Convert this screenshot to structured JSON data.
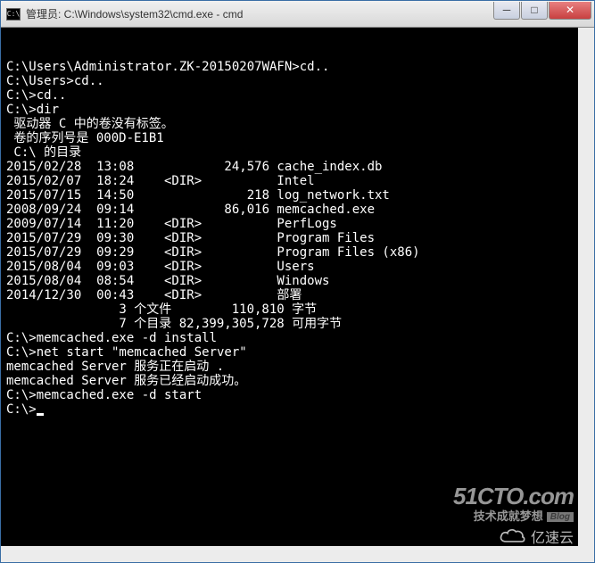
{
  "title": "管理员: C:\\Windows\\system32\\cmd.exe - cmd",
  "icon_text": "C:\\",
  "terminal_lines": [
    "",
    "C:\\Users\\Administrator.ZK-20150207WAFN>cd..",
    "",
    "C:\\Users>cd..",
    "",
    "C:\\>cd..",
    "",
    "C:\\>dir",
    " 驱动器 C 中的卷没有标签。",
    " 卷的序列号是 000D-E1B1",
    "",
    " C:\\ 的目录",
    "",
    "2015/02/28  13:08            24,576 cache_index.db",
    "2015/02/07  18:24    <DIR>          Intel",
    "2015/07/15  14:50               218 log_network.txt",
    "2008/09/24  09:14            86,016 memcached.exe",
    "2009/07/14  11:20    <DIR>          PerfLogs",
    "2015/07/29  09:30    <DIR>          Program Files",
    "2015/07/29  09:29    <DIR>          Program Files (x86)",
    "2015/08/04  09:03    <DIR>          Users",
    "2015/08/04  08:54    <DIR>          Windows",
    "2014/12/30  00:43    <DIR>          部署",
    "               3 个文件        110,810 字节",
    "               7 个目录 82,399,305,728 可用字节",
    "",
    "C:\\>memcached.exe -d install",
    "",
    "C:\\>net start \"memcached Server\"",
    "memcached Server 服务正在启动 .",
    "memcached Server 服务已经启动成功。",
    "",
    "",
    "C:\\>memcached.exe -d start",
    "",
    "C:\\>"
  ],
  "watermark": {
    "line1": "51CTO.com",
    "line2": "技术成就梦想",
    "blog": "Blog",
    "line3": "亿速云"
  },
  "buttons": {
    "min": "─",
    "max": "□",
    "close": "✕"
  }
}
